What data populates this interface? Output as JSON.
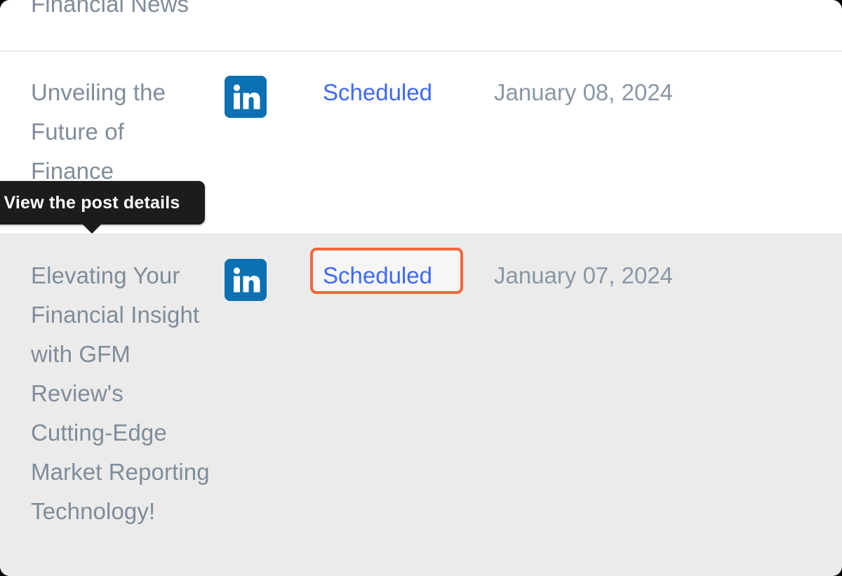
{
  "colors": {
    "page_background": "#000000",
    "row_white": "#ffffff",
    "row_gray": "#ebebeb",
    "title_text": "#7f8c9a",
    "date_text": "#8a97a5",
    "status_link": "#3e69f6",
    "highlight_border": "#f4663c",
    "tooltip_background": "#1c1c1c",
    "tooltip_text": "#ffffff",
    "linkedin_blue": "#0c71b3",
    "row_divider": "#e2e5e9"
  },
  "table": {
    "rows": [
      {
        "title": "Financial News",
        "clipped": true
      },
      {
        "title": "Unveiling the Future of Finance",
        "channel_icon": "linkedin-icon",
        "channel_name": "LinkedIn",
        "status": "Scheduled",
        "date": "January 08, 2024",
        "highlighted": false
      },
      {
        "title": "Elevating Your Financial Insight with GFM Review's Cutting-Edge Market Reporting Technology!",
        "channel_icon": "linkedin-icon",
        "channel_name": "LinkedIn",
        "status": "Scheduled",
        "date": "January 07, 2024",
        "highlighted": true
      }
    ]
  },
  "tooltip": {
    "text": "View the post details",
    "visible": true
  }
}
